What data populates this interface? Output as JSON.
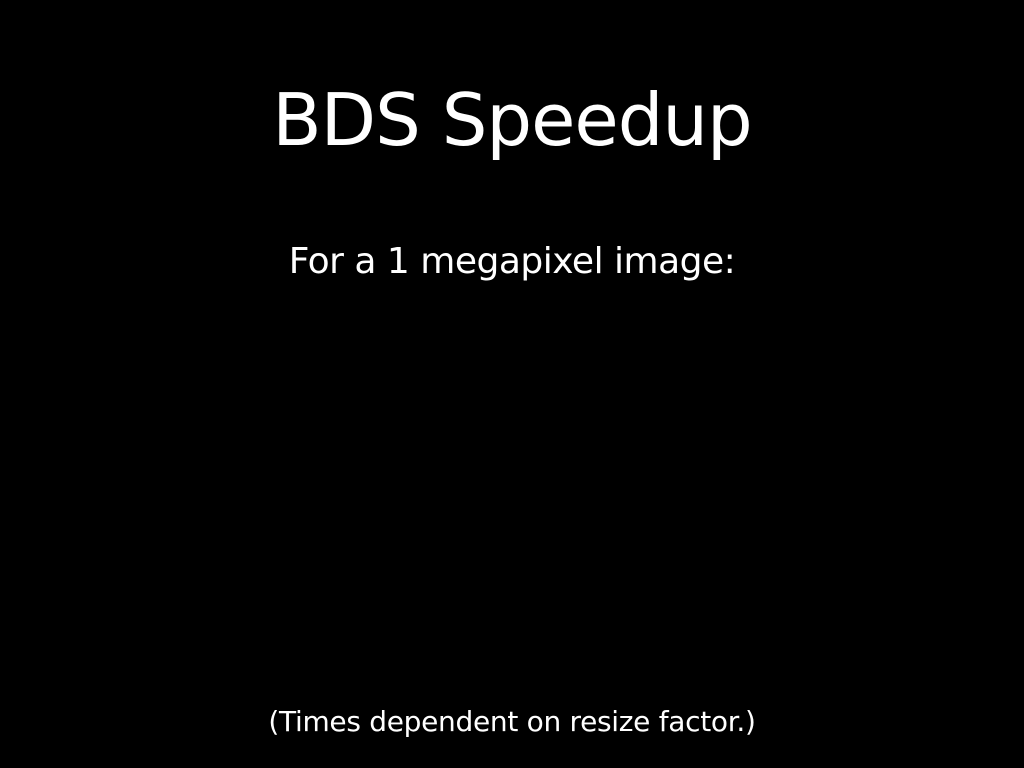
{
  "slide": {
    "title": "BDS Speedup",
    "subtitle": "For a 1 megapixel image:",
    "footnote": "(Times dependent on resize factor.)",
    "colors": {
      "background": "#000000",
      "text": "#ffffff"
    }
  }
}
